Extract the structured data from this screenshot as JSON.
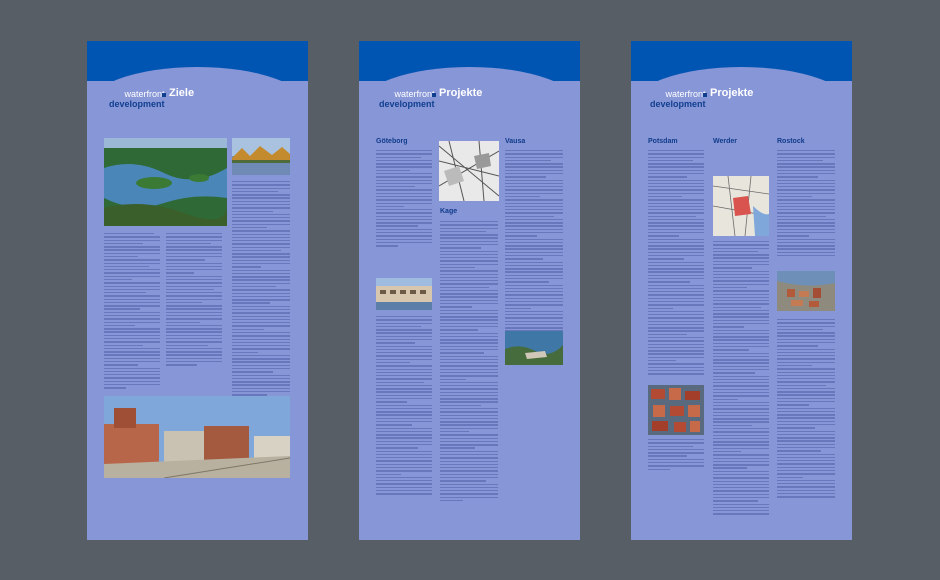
{
  "panels": [
    {
      "logo_top": "waterfront",
      "logo_bottom": "development",
      "title": "Ziele"
    },
    {
      "logo_top": "waterfront",
      "logo_bottom": "development",
      "title": "Projekte",
      "headings": {
        "goteborg": "Göteborg",
        "vausa": "Vausa",
        "kage": "Kage"
      }
    },
    {
      "logo_top": "waterfront",
      "logo_bottom": "development",
      "title": "Projekte",
      "headings": {
        "potsdam": "Potsdam",
        "werder": "Werder",
        "rostock": "Rostock"
      }
    }
  ],
  "colors": {
    "background": "#575e66",
    "panel": "#8796d6",
    "band": "#0055b3",
    "heading": "#103b8c"
  }
}
